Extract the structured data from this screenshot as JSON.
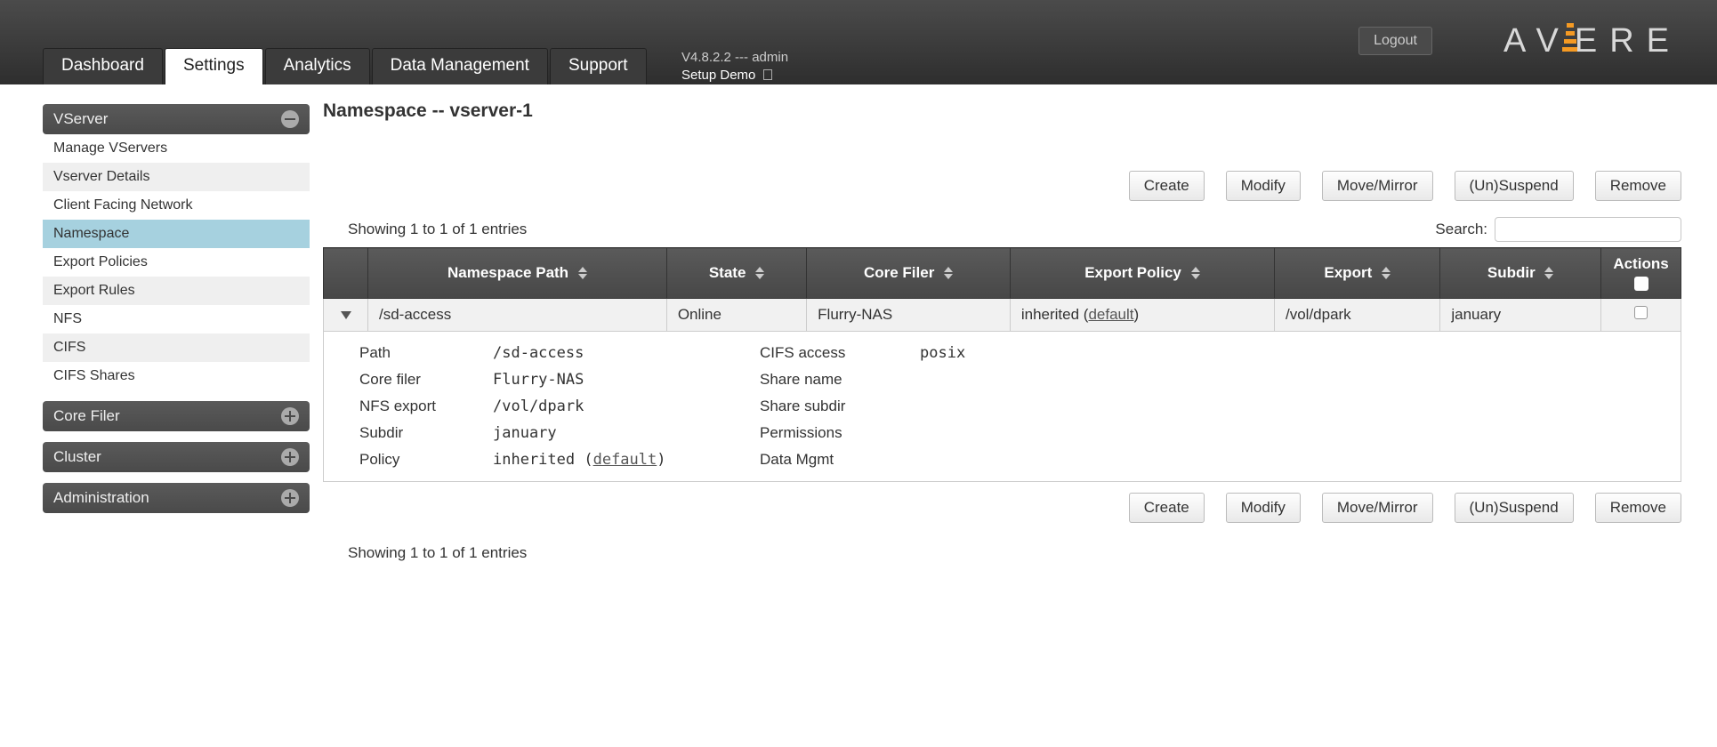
{
  "header": {
    "logout": "Logout",
    "logo_letters": [
      "A",
      "V",
      "E",
      "R",
      "E"
    ],
    "version_line": "V4.8.2.2 --- admin",
    "setup_demo": "Setup Demo"
  },
  "nav": {
    "tabs": [
      "Dashboard",
      "Settings",
      "Analytics",
      "Data Management",
      "Support"
    ],
    "active_index": 1
  },
  "sidebar": {
    "groups": [
      {
        "title": "VServer",
        "expanded": true,
        "items": [
          "Manage VServers",
          "Vserver Details",
          "Client Facing Network",
          "Namespace",
          "Export Policies",
          "Export Rules",
          "NFS",
          "CIFS",
          "CIFS Shares"
        ],
        "selected_index": 3
      },
      {
        "title": "Core Filer",
        "expanded": false
      },
      {
        "title": "Cluster",
        "expanded": false
      },
      {
        "title": "Administration",
        "expanded": false
      }
    ]
  },
  "page": {
    "title": "Namespace -- vserver-1",
    "actions": [
      "Create",
      "Modify",
      "Move/Mirror",
      "(Un)Suspend",
      "Remove"
    ],
    "entries_text": "Showing 1 to 1 of 1 entries",
    "search_label": "Search:"
  },
  "table": {
    "columns": [
      "",
      "Namespace Path",
      "State",
      "Core Filer",
      "Export Policy",
      "Export",
      "Subdir",
      "Actions"
    ],
    "row": {
      "path": "/sd-access",
      "state": "Online",
      "core_filer": "Flurry-NAS",
      "export_policy_prefix": "inherited (",
      "export_policy_link": "default",
      "export_policy_suffix": ")",
      "export": "/vol/dpark",
      "subdir": "january"
    },
    "detail": {
      "left_labels": [
        "Path",
        "Core filer",
        "NFS export",
        "Subdir",
        "Policy"
      ],
      "left_values": [
        "/sd-access",
        "Flurry-NAS",
        "/vol/dpark",
        "january"
      ],
      "policy_prefix": "inherited (",
      "policy_link": "default",
      "policy_suffix": ")",
      "right_labels": [
        "CIFS access",
        "Share name",
        "Share subdir",
        "Permissions",
        "Data Mgmt"
      ],
      "right_values": [
        "posix",
        "",
        "",
        "",
        ""
      ]
    }
  }
}
